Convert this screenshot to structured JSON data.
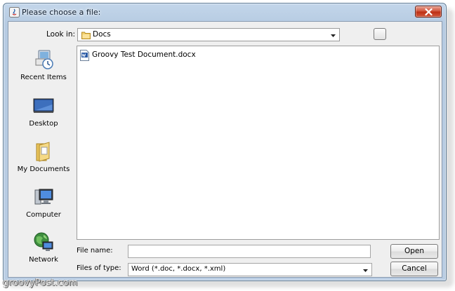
{
  "window": {
    "title": "Please choose a file:"
  },
  "toolbar": {
    "look_in_label": "Look in:",
    "look_in_value": "Docs"
  },
  "places": [
    {
      "label": "Recent Items",
      "icon": "recent-items-icon"
    },
    {
      "label": "Desktop",
      "icon": "desktop-icon"
    },
    {
      "label": "My Documents",
      "icon": "my-documents-icon"
    },
    {
      "label": "Computer",
      "icon": "computer-icon"
    },
    {
      "label": "Network",
      "icon": "network-icon"
    }
  ],
  "files": [
    {
      "name": "Groovy Test Document.docx",
      "icon": "word-document-icon"
    }
  ],
  "form": {
    "file_name_label": "File name:",
    "file_name_value": "",
    "files_of_type_label": "Files of type:",
    "files_of_type_value": "Word (*.doc, *.docx, *.xml)"
  },
  "buttons": {
    "open": "Open",
    "cancel": "Cancel"
  },
  "watermark": "groovyPost.com",
  "colors": {
    "titlebar": "#b9cde3",
    "close_button": "#c8401f",
    "panel": "#efefef"
  }
}
